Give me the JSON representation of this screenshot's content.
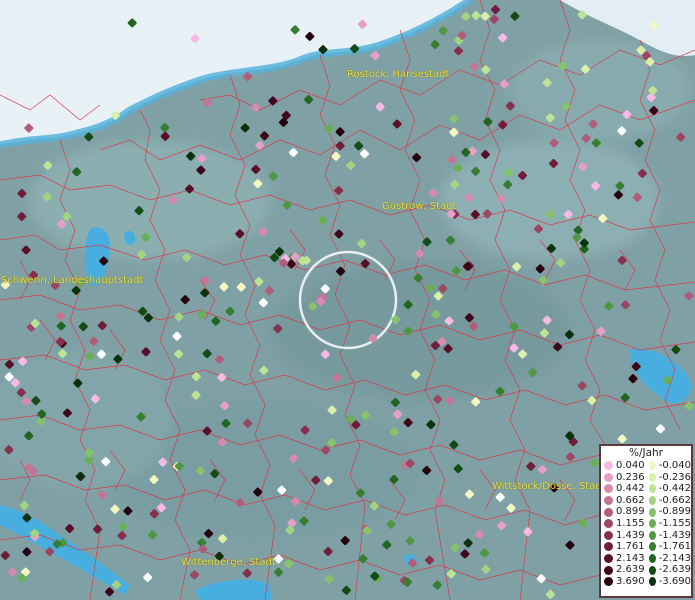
{
  "map": {
    "cities": [
      {
        "name": "Rostock, Hansestadt"
      },
      {
        "name": "Güstrow, Stadt"
      },
      {
        "name": "Schwerin, Landeshauptstadt"
      },
      {
        "name": "Wittstock/Dosse, Stadt"
      },
      {
        "name": "Wittenberge, Stadt"
      }
    ]
  },
  "legend": {
    "title": "%/Jahr",
    "positive": [
      {
        "label": "0.040",
        "color": "#f7b8e6"
      },
      {
        "label": "0.236",
        "color": "#e6a0c8"
      },
      {
        "label": "0.442",
        "color": "#d58aae"
      },
      {
        "label": "0.662",
        "color": "#c47495"
      },
      {
        "label": "0.899",
        "color": "#b05d7a"
      },
      {
        "label": "1.155",
        "color": "#9c4663"
      },
      {
        "label": "1.439",
        "color": "#86304d"
      },
      {
        "label": "1.761",
        "color": "#6f1d38"
      },
      {
        "label": "2.143",
        "color": "#561028"
      },
      {
        "label": "2.639",
        "color": "#3e0719"
      },
      {
        "label": "3.690",
        "color": "#250210"
      }
    ],
    "negative": [
      {
        "label": "-0.040",
        "color": "#f3f8c2"
      },
      {
        "label": "-0.236",
        "color": "#d9efaa"
      },
      {
        "label": "-0.442",
        "color": "#bfe395"
      },
      {
        "label": "-0.662",
        "color": "#a3d47f"
      },
      {
        "label": "-0.899",
        "color": "#86c36a"
      },
      {
        "label": "-1.155",
        "color": "#6aae55"
      },
      {
        "label": "-1.439",
        "color": "#4f9742"
      },
      {
        "label": "-1.761",
        "color": "#377e31"
      },
      {
        "label": "-2.143",
        "color": "#226522"
      },
      {
        "label": "-2.639",
        "color": "#134c16"
      },
      {
        "label": "-3.690",
        "color": "#0a330c"
      }
    ]
  }
}
